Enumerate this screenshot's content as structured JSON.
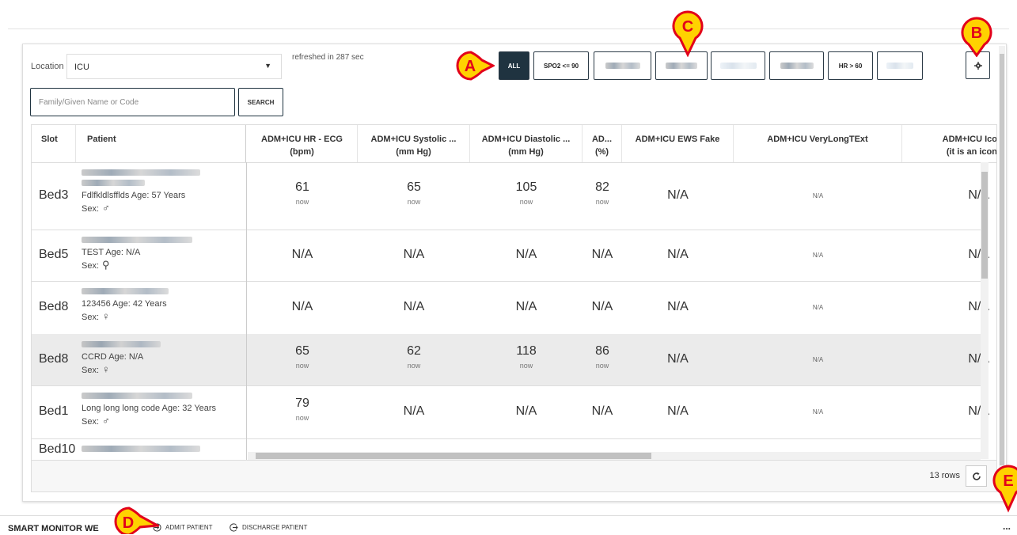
{
  "location": {
    "label": "Location",
    "value": "ICU",
    "refresh_text": "refreshed in 287 sec"
  },
  "filters": [
    {
      "label": "ALL",
      "active": true
    },
    {
      "label": "SPO2 <= 90"
    },
    {
      "label": ""
    },
    {
      "label": ""
    },
    {
      "label": ""
    },
    {
      "label": ""
    },
    {
      "label": "HR > 60"
    },
    {
      "label": ""
    }
  ],
  "search": {
    "placeholder": "Family/Given Name or Code",
    "button_label": "SEARCH"
  },
  "columns": [
    {
      "label": "Slot"
    },
    {
      "label": "Patient"
    },
    {
      "label": "ADM+ICU HR - ECG",
      "unit": "(bpm)"
    },
    {
      "label": "ADM+ICU Systolic ...",
      "unit": "(mm Hg)"
    },
    {
      "label": "ADM+ICU Diastolic ...",
      "unit": "(mm Hg)"
    },
    {
      "label": "AD...",
      "unit": "(%)"
    },
    {
      "label": "ADM+ICU EWS Fake"
    },
    {
      "label": "ADM+ICU VeryLongTExt"
    },
    {
      "label": "ADM+ICU Ico",
      "unit": "(it is an icon"
    }
  ],
  "rows": [
    {
      "slot": "Bed3",
      "info": "Fdlfkldlsfflds Age: 57 Years",
      "sex_label": "Sex:",
      "sex": "♂",
      "hr": "61",
      "hr_t": "now",
      "sys": "65",
      "sys_t": "now",
      "dia": "105",
      "dia_t": "now",
      "sp": "82",
      "sp_t": "now",
      "ews": "N/A",
      "vlt": "N/A",
      "ico": "N/A",
      "selected": false
    },
    {
      "slot": "Bed5",
      "info": "TEST Age: N/A",
      "sex_label": "Sex:",
      "sex": "⚲",
      "hr": "N/A",
      "hr_t": "",
      "sys": "N/A",
      "sys_t": "",
      "dia": "N/A",
      "dia_t": "",
      "sp": "N/A",
      "sp_t": "",
      "ews": "N/A",
      "vlt": "N/A",
      "ico": "N/A",
      "selected": false
    },
    {
      "slot": "Bed8",
      "info": "123456 Age: 42 Years",
      "sex_label": "Sex:",
      "sex": "♀",
      "hr": "N/A",
      "hr_t": "",
      "sys": "N/A",
      "sys_t": "",
      "dia": "N/A",
      "dia_t": "",
      "sp": "N/A",
      "sp_t": "",
      "ews": "N/A",
      "vlt": "N/A",
      "ico": "N/A",
      "selected": false
    },
    {
      "slot": "Bed8",
      "info": "CCRD Age: N/A",
      "sex_label": "Sex:",
      "sex": "♀",
      "hr": "65",
      "hr_t": "now",
      "sys": "62",
      "sys_t": "now",
      "dia": "118",
      "dia_t": "now",
      "sp": "86",
      "sp_t": "now",
      "ews": "N/A",
      "vlt": "N/A",
      "ico": "N/A",
      "selected": true
    },
    {
      "slot": "Bed1",
      "info": "Long long long code Age: 32 Years",
      "sex_label": "Sex:",
      "sex": "♂",
      "hr": "79",
      "hr_t": "now",
      "sys": "N/A",
      "sys_t": "",
      "dia": "N/A",
      "dia_t": "",
      "sp": "N/A",
      "sp_t": "",
      "ews": "N/A",
      "vlt": "N/A",
      "ico": "N/A",
      "selected": false
    },
    {
      "slot": "Bed10",
      "info": "",
      "sex_label": "",
      "sex": "",
      "hr": "",
      "hr_t": "",
      "sys": "",
      "sys_t": "",
      "dia": "",
      "dia_t": "",
      "sp": "",
      "sp_t": "",
      "ews": "",
      "vlt": "",
      "ico": "",
      "selected": false
    }
  ],
  "footer": {
    "row_count": "13 rows"
  },
  "bottom_bar": {
    "app_title": "SMART MONITOR WE",
    "admit": "ADMIT PATIENT",
    "discharge": "DISCHARGE PATIENT",
    "more": "..."
  },
  "callouts": [
    "A",
    "B",
    "C",
    "D",
    "E"
  ],
  "colors": {
    "accent": "#1f3340",
    "callout": "#ffd200",
    "callout_border": "#e2001a"
  }
}
